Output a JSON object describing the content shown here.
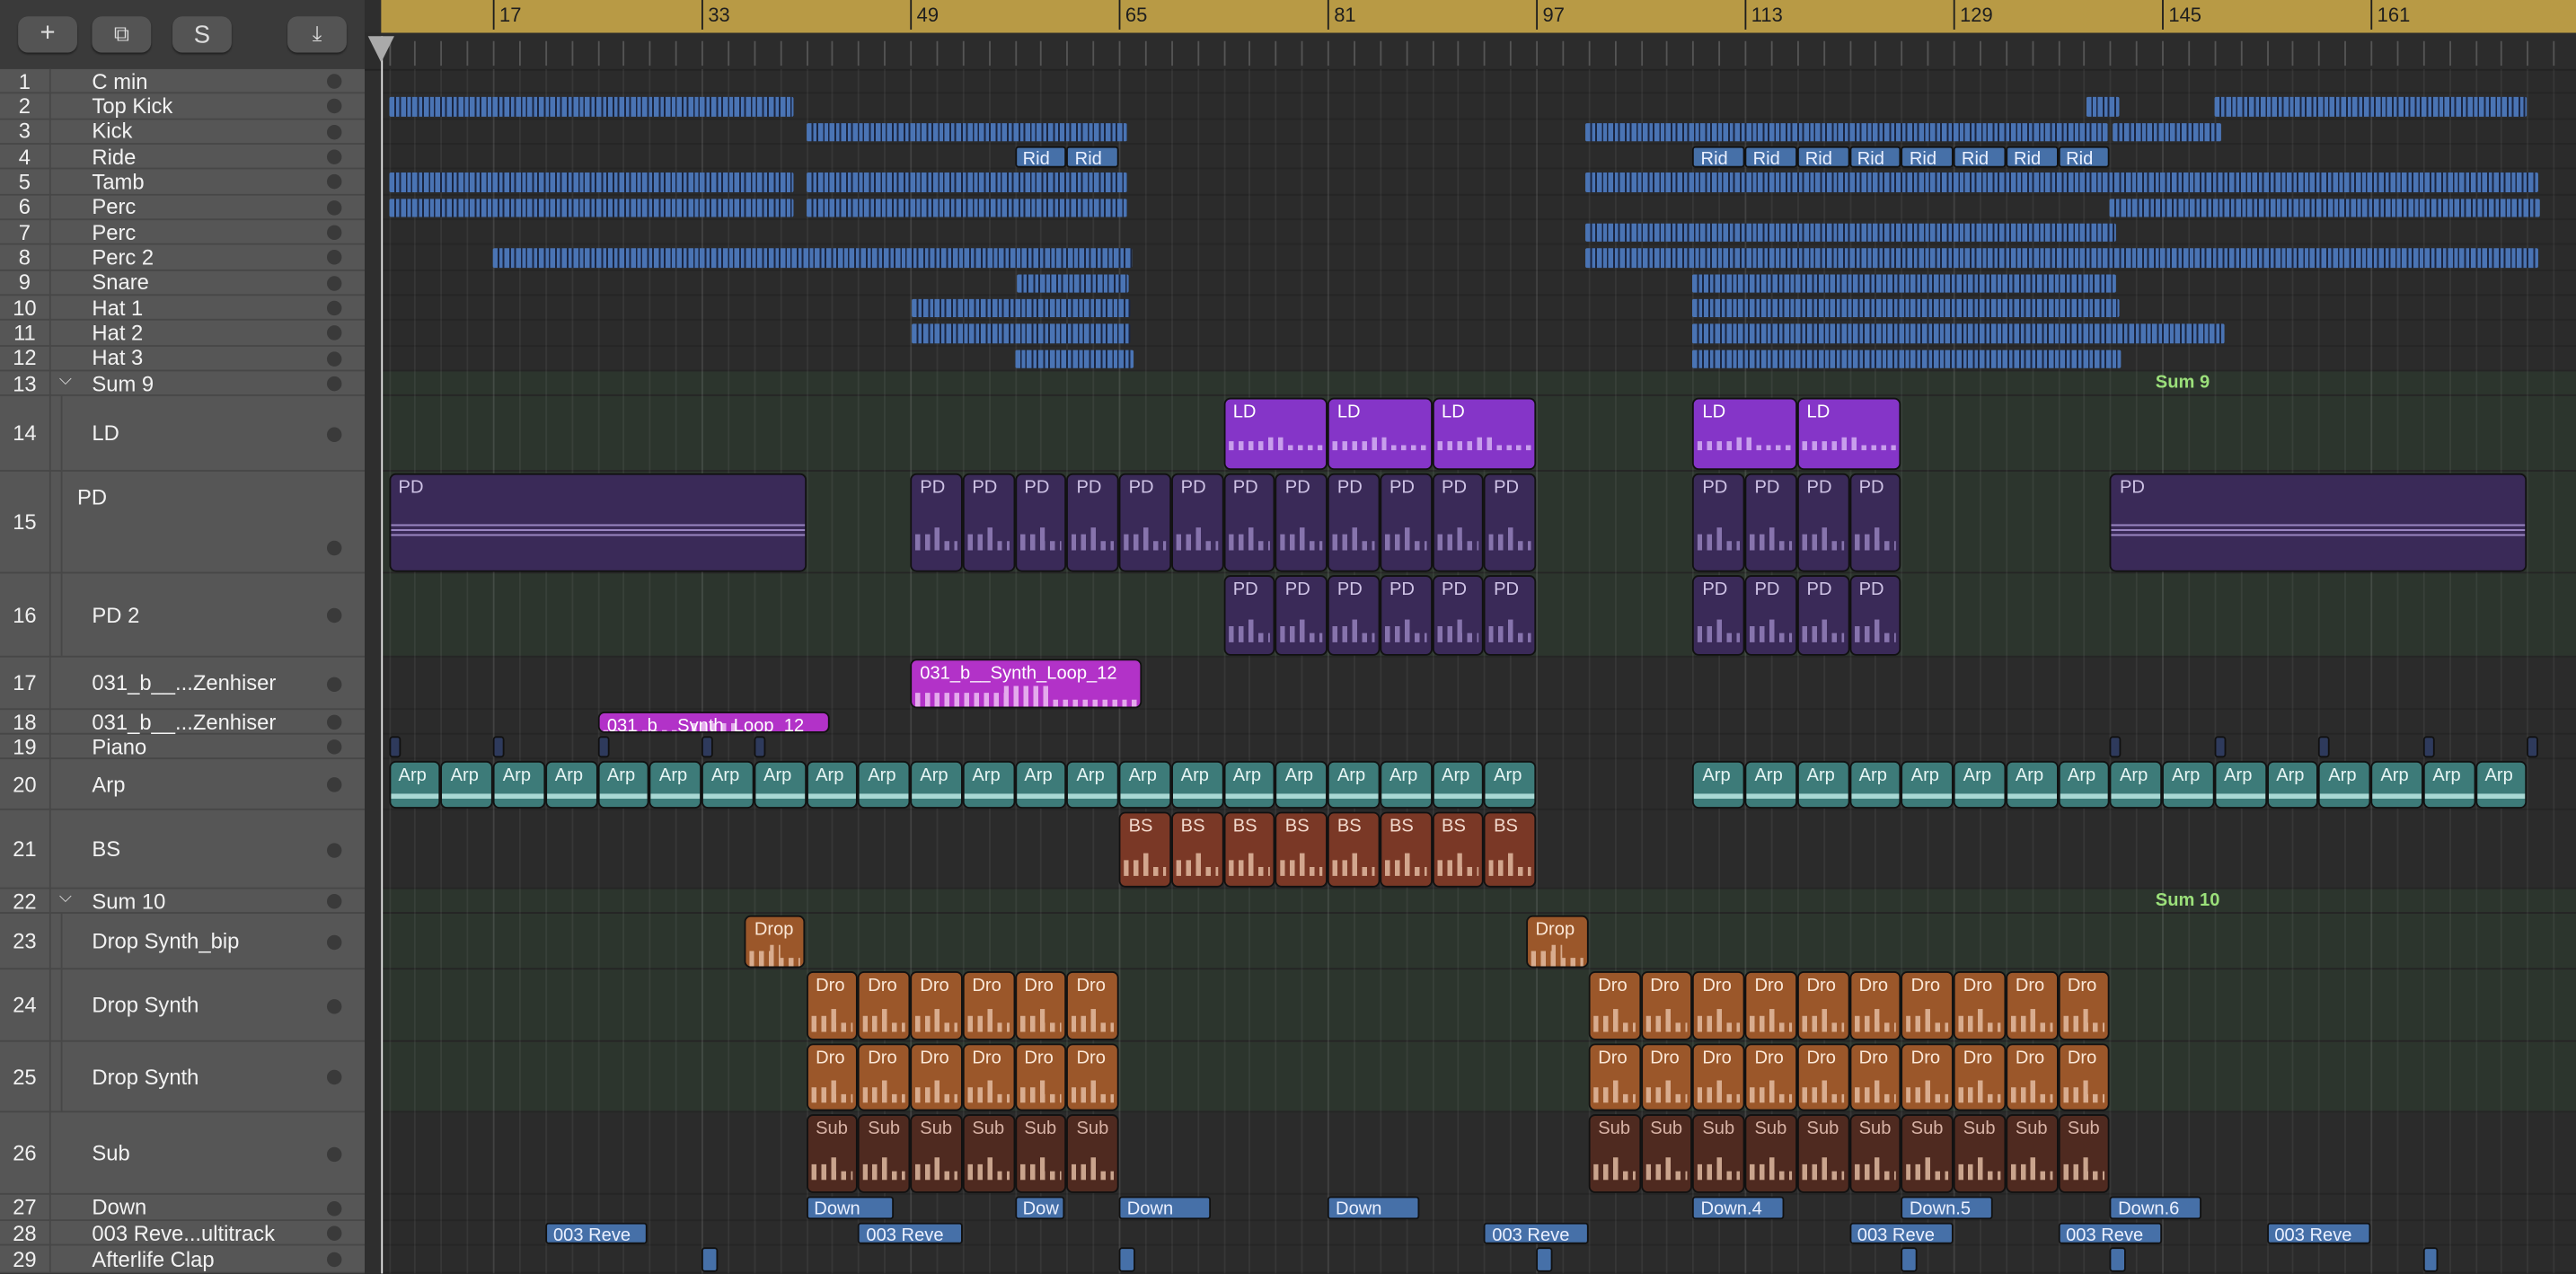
{
  "toolbar": {
    "add": "+",
    "duplicate": "⧉",
    "solo": "S",
    "download": "⤓"
  },
  "ruler": {
    "bars": [
      "17",
      "33",
      "49",
      "65",
      "81",
      "97",
      "113",
      "129",
      "145",
      "161"
    ]
  },
  "tracks": [
    {
      "num": "1",
      "name": "C min"
    },
    {
      "num": "2",
      "name": "Top Kick"
    },
    {
      "num": "3",
      "name": "Kick"
    },
    {
      "num": "4",
      "name": "Ride"
    },
    {
      "num": "5",
      "name": "Tamb"
    },
    {
      "num": "6",
      "name": "Perc"
    },
    {
      "num": "7",
      "name": "Perc"
    },
    {
      "num": "8",
      "name": "Perc 2"
    },
    {
      "num": "9",
      "name": "Snare"
    },
    {
      "num": "10",
      "name": "Hat 1"
    },
    {
      "num": "11",
      "name": "Hat 2"
    },
    {
      "num": "12",
      "name": "Hat 3"
    },
    {
      "num": "13",
      "name": "Sum 9",
      "folder": true
    },
    {
      "num": "14",
      "name": "LD",
      "child": true
    },
    {
      "num": "15",
      "name": "PD",
      "child": true
    },
    {
      "num": "16",
      "name": "PD 2",
      "child": true
    },
    {
      "num": "17",
      "name": "031_b__...Zenhiser"
    },
    {
      "num": "18",
      "name": "031_b__...Zenhiser"
    },
    {
      "num": "19",
      "name": "Piano"
    },
    {
      "num": "20",
      "name": "Arp"
    },
    {
      "num": "21",
      "name": "BS"
    },
    {
      "num": "22",
      "name": "Sum 10",
      "folder": true
    },
    {
      "num": "23",
      "name": "Drop Synth_bip",
      "child": true
    },
    {
      "num": "24",
      "name": "Drop Synth",
      "child": true
    },
    {
      "num": "25",
      "name": "Drop Synth",
      "child": true
    },
    {
      "num": "26",
      "name": "Sub"
    },
    {
      "num": "27",
      "name": "Down"
    },
    {
      "num": "28",
      "name": "003 Reve...ultitrack"
    },
    {
      "num": "29",
      "name": "Afterlife Clap"
    }
  ],
  "folder_labels": [
    {
      "track": 13,
      "label": "Sum 9"
    },
    {
      "track": 22,
      "label": "Sum 10"
    }
  ],
  "colors": {
    "drum": "#4a74b4",
    "ld": "#8535c8",
    "pd": "#3a2a58",
    "loop": "#b232c8",
    "arp": "#3d7b79",
    "bs": "#7a3826",
    "drop": "#9b572a",
    "sub": "#4f2a20",
    "audio": "#4670a8",
    "piano": "#2e3a5c",
    "ruler": "#b89a45"
  },
  "regions": [
    {
      "track": 2,
      "type": "drum",
      "start": 9,
      "len": 31
    },
    {
      "track": 2,
      "type": "drum",
      "start": 139.2,
      "len": 2.5
    },
    {
      "track": 2,
      "type": "drum",
      "start": 149,
      "len": 24
    },
    {
      "track": 3,
      "type": "drum",
      "start": 41,
      "len": 24.6
    },
    {
      "track": 3,
      "type": "drum",
      "start": 100.8,
      "len": 40
    },
    {
      "track": 3,
      "type": "drum",
      "start": 141.2,
      "len": 8.3
    },
    {
      "track": 4,
      "type": "audio",
      "label": "Rid",
      "start": 57,
      "len": 4,
      "count": 2
    },
    {
      "track": 4,
      "type": "audio",
      "label": "Rid",
      "start": 109,
      "len": 4,
      "count": 8
    },
    {
      "track": 5,
      "type": "drum",
      "start": 9,
      "len": 31
    },
    {
      "track": 5,
      "type": "drum",
      "start": 41,
      "len": 24.6
    },
    {
      "track": 5,
      "type": "drum",
      "start": 100.8,
      "len": 73
    },
    {
      "track": 6,
      "type": "drum",
      "start": 9,
      "len": 31
    },
    {
      "track": 6,
      "type": "drum",
      "start": 41,
      "len": 24.6
    },
    {
      "track": 6,
      "type": "drum",
      "start": 141,
      "len": 33
    },
    {
      "track": 7,
      "type": "drum",
      "start": 100.8,
      "len": 40.7
    },
    {
      "track": 8,
      "type": "drum",
      "start": 17,
      "len": 49
    },
    {
      "track": 8,
      "type": "drum",
      "start": 100.8,
      "len": 73
    },
    {
      "track": 9,
      "type": "drum",
      "start": 57.2,
      "len": 8.6
    },
    {
      "track": 9,
      "type": "drum",
      "start": 109,
      "len": 32.5
    },
    {
      "track": 10,
      "type": "drum",
      "start": 49.1,
      "len": 16.8
    },
    {
      "track": 10,
      "type": "drum",
      "start": 109,
      "len": 32.7
    },
    {
      "track": 11,
      "type": "drum",
      "start": 49.1,
      "len": 16.8
    },
    {
      "track": 11,
      "type": "drum",
      "start": 109,
      "len": 40.8
    },
    {
      "track": 12,
      "type": "drum",
      "start": 57,
      "len": 9.1
    },
    {
      "track": 12,
      "type": "drum",
      "start": 109,
      "len": 32.9
    },
    {
      "track": 14,
      "type": "ld",
      "label": "LD",
      "start": 73,
      "len": 8,
      "count": 3
    },
    {
      "track": 14,
      "type": "ld",
      "label": "LD",
      "start": 109,
      "len": 8,
      "count": 2
    },
    {
      "track": 15,
      "type": "pdlong",
      "label": "PD",
      "start": 9,
      "len": 32
    },
    {
      "track": 15,
      "type": "pd",
      "label": "PD",
      "start": 49,
      "len": 4,
      "count": 12
    },
    {
      "track": 15,
      "type": "pd",
      "label": "PD",
      "start": 109,
      "len": 4,
      "count": 4
    },
    {
      "track": 15,
      "type": "pdlong",
      "label": "PD",
      "start": 141,
      "len": 32
    },
    {
      "track": 16,
      "type": "pd",
      "label": "PD",
      "start": 73,
      "len": 4,
      "count": 6
    },
    {
      "track": 16,
      "type": "pd",
      "label": "PD",
      "start": 109,
      "len": 4,
      "count": 4
    },
    {
      "track": 17,
      "type": "loop",
      "label": "031_b__Synth_Loop_12",
      "start": 49,
      "len": 17.8
    },
    {
      "track": 18,
      "type": "loop",
      "label": "031_b__Synth_Loop_12",
      "start": 25,
      "len": 17.8
    },
    {
      "track": 19,
      "type": "piano",
      "start": 9,
      "len": 0.9
    },
    {
      "track": 19,
      "type": "piano",
      "start": 17,
      "len": 0.9
    },
    {
      "track": 19,
      "type": "piano",
      "start": 25,
      "len": 0.9
    },
    {
      "track": 19,
      "type": "piano",
      "start": 33,
      "len": 0.9
    },
    {
      "track": 19,
      "type": "piano",
      "start": 37,
      "len": 0.9
    },
    {
      "track": 19,
      "type": "piano",
      "start": 141,
      "len": 0.9
    },
    {
      "track": 19,
      "type": "piano",
      "start": 149,
      "len": 0.9
    },
    {
      "track": 19,
      "type": "piano",
      "start": 157,
      "len": 0.9
    },
    {
      "track": 19,
      "type": "piano",
      "start": 165,
      "len": 0.9
    },
    {
      "track": 19,
      "type": "piano",
      "start": 173,
      "len": 0.9
    },
    {
      "track": 20,
      "type": "arp",
      "label": "Arp",
      "start": 9,
      "len": 4,
      "count": 22
    },
    {
      "track": 20,
      "type": "arp",
      "label": "Arp",
      "start": 109,
      "len": 4,
      "count": 16
    },
    {
      "track": 21,
      "type": "bs",
      "label": "BS",
      "start": 65,
      "len": 4,
      "count": 8
    },
    {
      "track": 23,
      "type": "drop",
      "label": "Drop",
      "start": 36.3,
      "len": 4.7
    },
    {
      "track": 23,
      "type": "drop",
      "label": "Drop",
      "start": 96.2,
      "len": 4.8
    },
    {
      "track": 24,
      "type": "drop",
      "label": "Dro",
      "start": 41,
      "len": 4,
      "count": 6
    },
    {
      "track": 24,
      "type": "drop",
      "label": "Dro",
      "start": 101,
      "len": 4,
      "count": 10
    },
    {
      "track": 25,
      "type": "drop",
      "label": "Dro",
      "start": 41,
      "len": 4,
      "count": 6
    },
    {
      "track": 25,
      "type": "drop",
      "label": "Dro",
      "start": 101,
      "len": 4,
      "count": 10
    },
    {
      "track": 26,
      "type": "sub",
      "label": "Sub",
      "start": 41,
      "len": 4,
      "count": 6
    },
    {
      "track": 26,
      "type": "sub",
      "label": "Sub",
      "start": 101,
      "len": 4,
      "count": 10
    },
    {
      "track": 27,
      "type": "audio",
      "label": "Down",
      "start": 41,
      "len": 6.8
    },
    {
      "track": 27,
      "type": "audio",
      "label": "Dow",
      "start": 57,
      "len": 3.8
    },
    {
      "track": 27,
      "type": "audio",
      "label": "Down",
      "start": 65,
      "len": 7
    },
    {
      "track": 27,
      "type": "audio",
      "label": "Down",
      "start": 81,
      "len": 7
    },
    {
      "track": 27,
      "type": "audio",
      "label": "Down.4",
      "start": 109,
      "len": 7
    },
    {
      "track": 27,
      "type": "audio",
      "label": "Down.5",
      "start": 125,
      "len": 7
    },
    {
      "track": 27,
      "type": "audio",
      "label": "Down.6",
      "start": 141,
      "len": 7
    },
    {
      "track": 28,
      "type": "audio",
      "label": "003 Reve",
      "start": 21,
      "len": 7.8
    },
    {
      "track": 28,
      "type": "audio",
      "label": "003 Reve",
      "start": 45,
      "len": 8
    },
    {
      "track": 28,
      "type": "audio",
      "label": "003 Reve",
      "start": 93,
      "len": 8
    },
    {
      "track": 28,
      "type": "audio",
      "label": "003 Reve",
      "start": 121,
      "len": 8
    },
    {
      "track": 28,
      "type": "audio",
      "label": "003 Reve",
      "start": 137,
      "len": 8
    },
    {
      "track": 28,
      "type": "audio",
      "label": "003 Reve",
      "start": 153,
      "len": 8
    },
    {
      "track": 29,
      "type": "audio",
      "start": 33,
      "len": 1.2
    },
    {
      "track": 29,
      "type": "audio",
      "start": 65,
      "len": 1.2
    },
    {
      "track": 29,
      "type": "audio",
      "start": 97,
      "len": 1.2
    },
    {
      "track": 29,
      "type": "audio",
      "start": 125,
      "len": 1.2
    },
    {
      "track": 29,
      "type": "audio",
      "start": 141,
      "len": 1.2
    },
    {
      "track": 29,
      "type": "audio",
      "start": 165,
      "len": 1.2
    }
  ]
}
